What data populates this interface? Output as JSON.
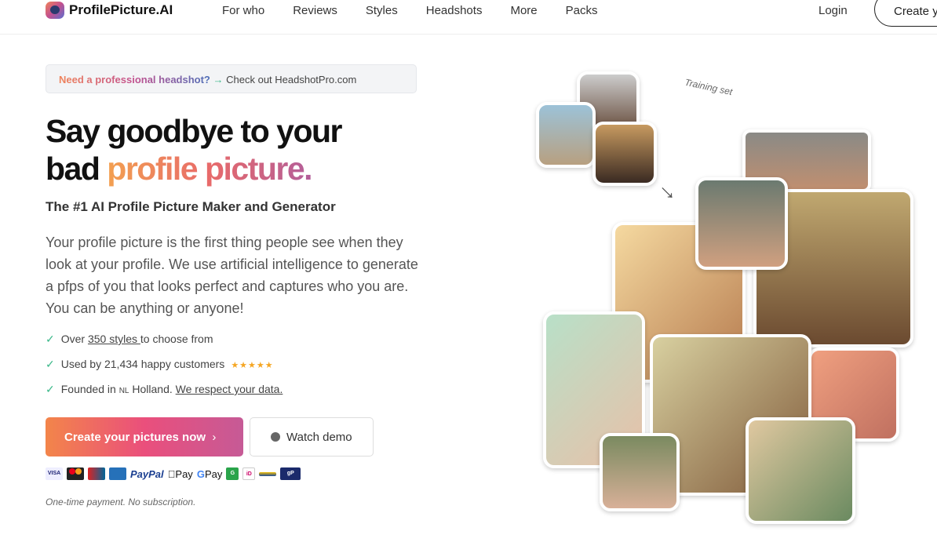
{
  "nav": {
    "logo": "ProfilePicture.AI",
    "links": [
      "For who",
      "Reviews",
      "Styles",
      "Headshots",
      "More",
      "Packs"
    ],
    "login": "Login",
    "create": "Create y"
  },
  "banner": {
    "highlight": "Need a professional headshot?",
    "arrow": "→",
    "link": "Check out HeadshotPro.com"
  },
  "hero": {
    "title_line1": "Say goodbye to your",
    "title_bad": "bad ",
    "title_grad": "profile picture.",
    "subtitle": "The #1 AI Profile Picture Maker and Generator",
    "description": "Your profile picture is the first thing people see when they look at your profile. We use artificial intelligence to generate a pfps of you that looks perfect and captures who you are. You can be anything or anyone!"
  },
  "features": {
    "f1_pre": "Over ",
    "f1_link": "350 styles ",
    "f1_post": "to choose from",
    "f2": "Used by 21,434 happy customers",
    "stars": "★★★★★",
    "rating": 5,
    "f3_pre": "Founded in ",
    "f3_flag": "NL",
    "f3_mid": " Holland. ",
    "f3_link": "We respect your data."
  },
  "buttons": {
    "cta": "Create your pictures now",
    "cta_chevron": "›",
    "demo": "Watch demo"
  },
  "payments": {
    "visa": "VISA",
    "paypal": "PayPal",
    "applepay": "Pay",
    "gpay": "Pay",
    "g": "G",
    "gp": "gP"
  },
  "note": "One-time payment. No subscription.",
  "gallery": {
    "training_label": "Training set"
  },
  "colors": {
    "accent_start": "#f3854a",
    "accent_end": "#c65a96",
    "check": "#3cb88a",
    "star": "#f5a623"
  }
}
